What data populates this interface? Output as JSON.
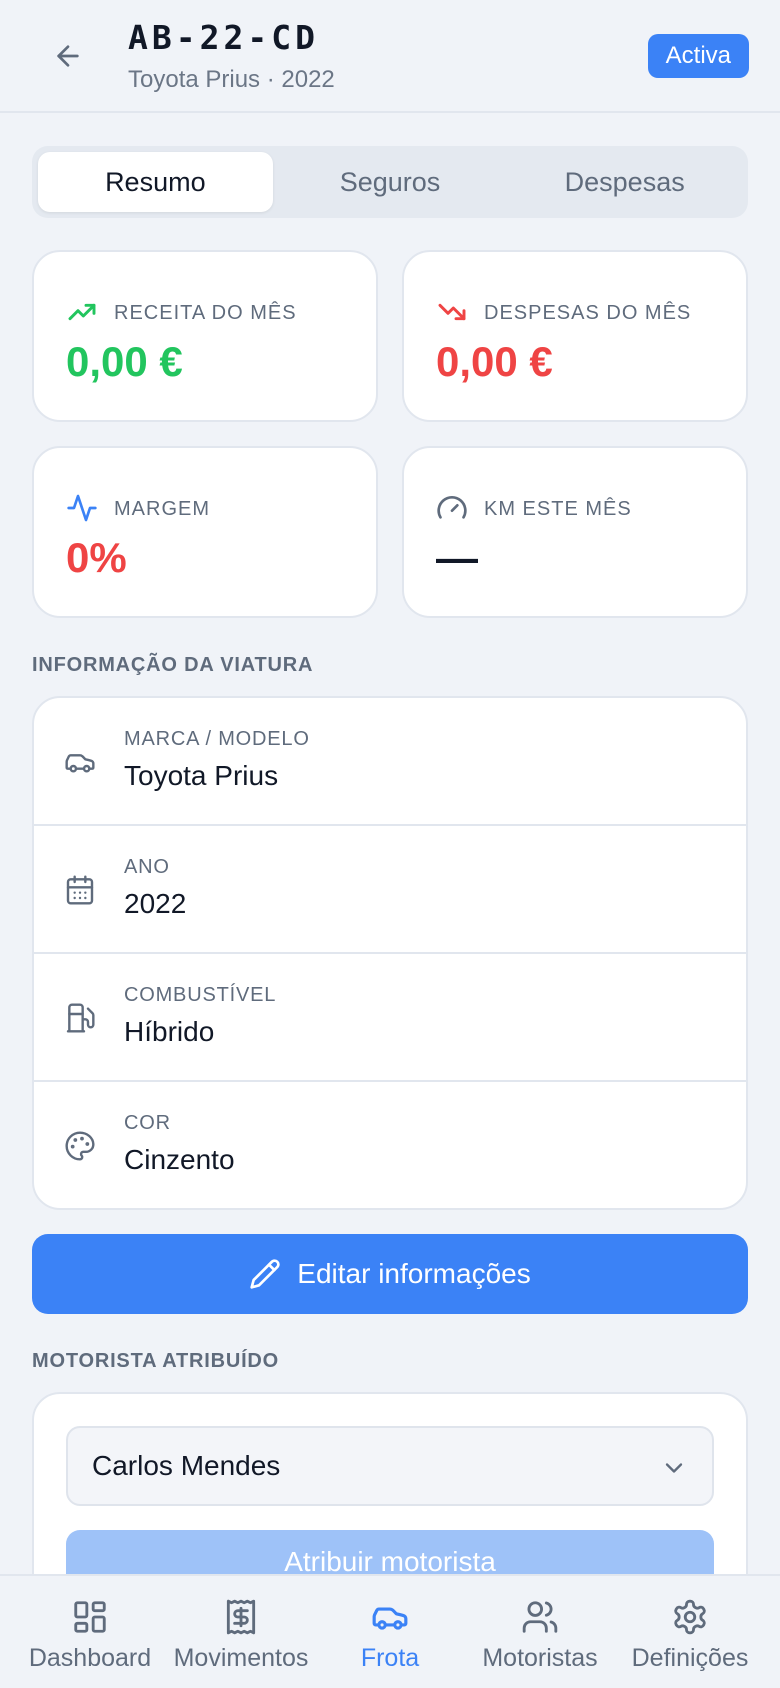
{
  "header": {
    "plate": "AB-22-CD",
    "subtitle": "Toyota Prius · 2022",
    "status": "Activa"
  },
  "tabs": [
    {
      "label": "Resumo",
      "active": true
    },
    {
      "label": "Seguros",
      "active": false
    },
    {
      "label": "Despesas",
      "active": false
    }
  ],
  "stats": {
    "revenue": {
      "label": "RECEITA DO MÊS",
      "value": "0,00 €",
      "icon": "trending-up-icon"
    },
    "expenses": {
      "label": "DESPESAS DO MÊS",
      "value": "0,00 €",
      "icon": "trending-down-icon"
    },
    "margin": {
      "label": "MARGEM",
      "value": "0%",
      "icon": "activity-icon"
    },
    "km": {
      "label": "KM ESTE MÊS",
      "value": "—",
      "icon": "gauge-icon"
    }
  },
  "vehicle_info": {
    "title": "INFORMAÇÃO DA VIATURA",
    "rows": [
      {
        "label": "MARCA / MODELO",
        "value": "Toyota Prius",
        "icon": "car-icon"
      },
      {
        "label": "ANO",
        "value": "2022",
        "icon": "calendar-icon"
      },
      {
        "label": "COMBUSTÍVEL",
        "value": "Híbrido",
        "icon": "fuel-icon"
      },
      {
        "label": "COR",
        "value": "Cinzento",
        "icon": "palette-icon"
      }
    ],
    "edit_label": "Editar informações"
  },
  "driver": {
    "title": "MOTORISTA ATRIBUÍDO",
    "selected": "Carlos Mendes",
    "assign_label": "Atribuir motorista"
  },
  "nav": [
    {
      "label": "Dashboard",
      "icon": "dashboard-icon",
      "active": false
    },
    {
      "label": "Movimentos",
      "icon": "receipt-icon",
      "active": false
    },
    {
      "label": "Frota",
      "icon": "car-icon",
      "active": true
    },
    {
      "label": "Motoristas",
      "icon": "users-icon",
      "active": false
    },
    {
      "label": "Definições",
      "icon": "settings-icon",
      "active": false
    }
  ],
  "colors": {
    "accent": "#3b82f6",
    "positive": "#22c55e",
    "negative": "#ef4444"
  }
}
